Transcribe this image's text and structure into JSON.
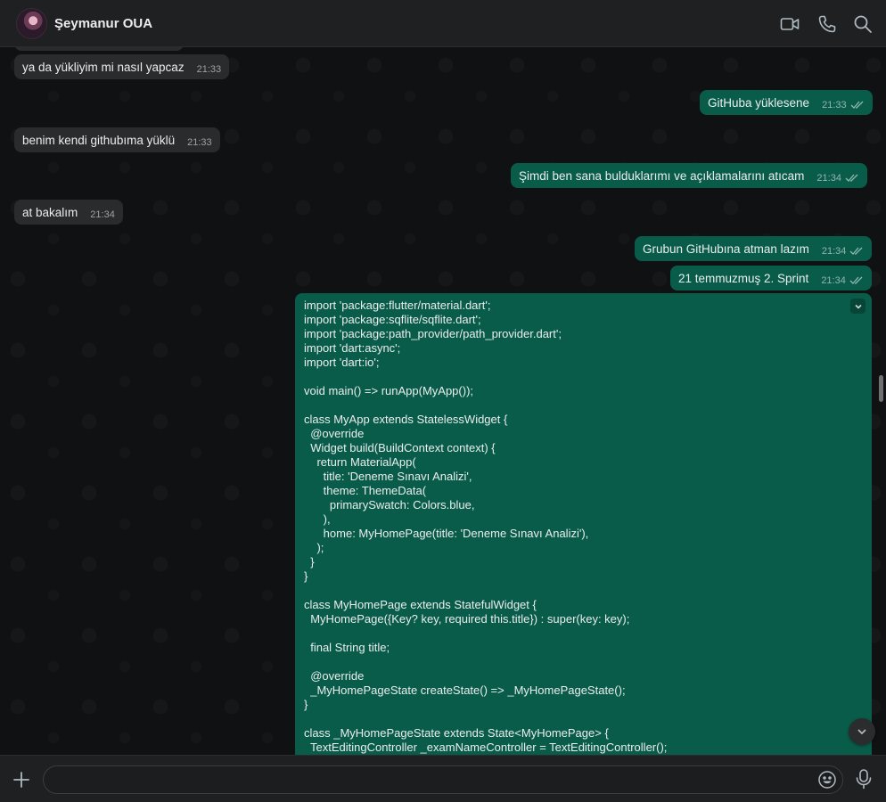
{
  "header": {
    "contact_name": "Şeymanur OUA",
    "icons": [
      "video-call-icon",
      "voice-call-icon",
      "search-icon"
    ]
  },
  "messages": [
    {
      "direction": "in",
      "text": "ya da yükliyim mi nasıl yapcaz",
      "time": "21:33"
    },
    {
      "direction": "out",
      "text": "GitHuba yüklesene",
      "time": "21:33",
      "status": "read"
    },
    {
      "direction": "in",
      "text": "benim kendi githubıma yüklü",
      "time": "21:33"
    },
    {
      "direction": "out",
      "text": "Şimdi ben sana bulduklarımı ve açıklamalarını atıcam",
      "time": "21:34",
      "status": "read"
    },
    {
      "direction": "in",
      "text": "at bakalım",
      "time": "21:34"
    },
    {
      "direction": "out",
      "text": "Grubun GitHubına atman lazım",
      "time": "21:34",
      "status": "read"
    },
    {
      "direction": "out",
      "text": "21 temmuzmuş 2. Sprint",
      "time": "21:34",
      "status": "read"
    }
  ],
  "code_message": {
    "direction": "out",
    "lines": [
      "import 'package:flutter/material.dart';",
      "import 'package:sqflite/sqflite.dart';",
      "import 'package:path_provider/path_provider.dart';",
      "import 'dart:async';",
      "import 'dart:io';",
      "",
      "void main() => runApp(MyApp());",
      "",
      "class MyApp extends StatelessWidget {",
      "  @override",
      "  Widget build(BuildContext context) {",
      "    return MaterialApp(",
      "      title: 'Deneme Sınavı Analizi',",
      "      theme: ThemeData(",
      "        primarySwatch: Colors.blue,",
      "      ),",
      "      home: MyHomePage(title: 'Deneme Sınavı Analizi'),",
      "    );",
      "  }",
      "}",
      "",
      "class MyHomePage extends StatefulWidget {",
      "  MyHomePage({Key? key, required this.title}) : super(key: key);",
      "",
      "  final String title;",
      "",
      "  @override",
      "  _MyHomePageState createState() => _MyHomePageState();",
      "}",
      "",
      "class _MyHomePageState extends State<MyHomePage> {",
      "  TextEditingController _examNameController = TextEditingController();"
    ]
  },
  "composer": {
    "placeholder": "",
    "icons": [
      "plus-icon",
      "emoji-icon",
      "microphone-icon"
    ]
  },
  "colors": {
    "incoming_bubble": "#2a2b2c",
    "outgoing_bubble": "#0a5c4a",
    "background": "#101112"
  }
}
